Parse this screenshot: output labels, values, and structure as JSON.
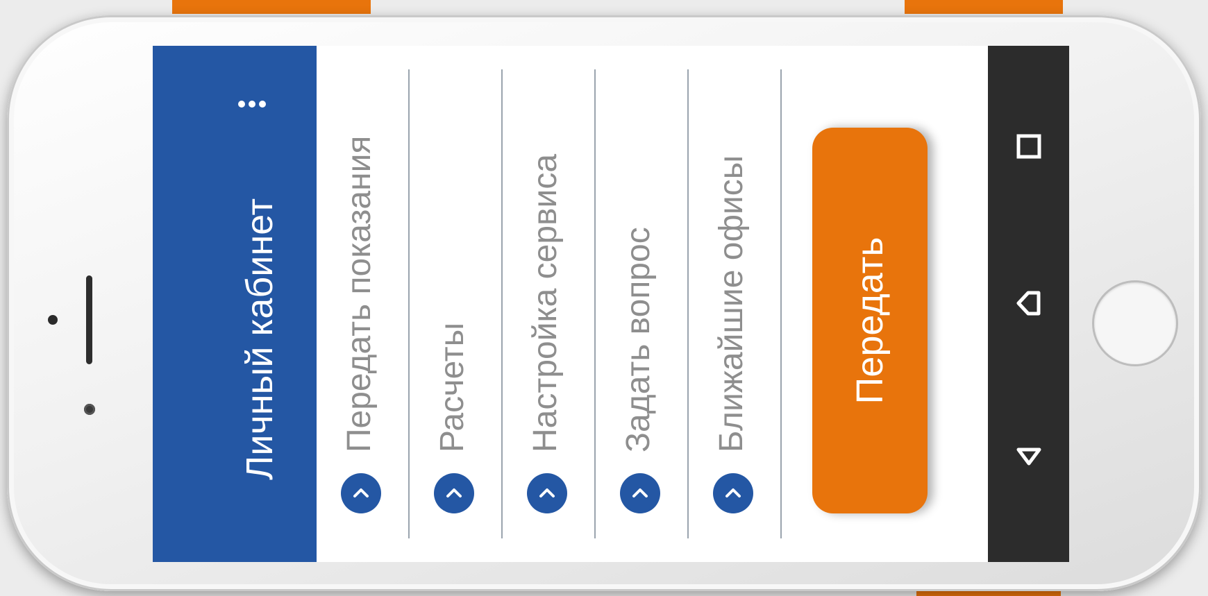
{
  "colors": {
    "brand_blue": "#2457a4",
    "accent_orange": "#e8740c",
    "system_bar": "#2c2c2c",
    "menu_text": "#8e8e8e"
  },
  "header": {
    "title": "Личный кабинет",
    "more_icon": "more-vertical-icon"
  },
  "menu": {
    "items": [
      {
        "label": "Передать показания",
        "icon": "chevron-right-icon"
      },
      {
        "label": "Расчеты",
        "icon": "chevron-right-icon"
      },
      {
        "label": "Настройка сервиса",
        "icon": "chevron-right-icon"
      },
      {
        "label": "Задать вопрос",
        "icon": "chevron-right-icon"
      },
      {
        "label": "Ближайшие офисы",
        "icon": "chevron-right-icon"
      }
    ]
  },
  "actions": {
    "submit_label": "Передать"
  },
  "system_nav": {
    "buttons": [
      "back-icon",
      "home-icon",
      "recent-apps-icon"
    ]
  }
}
